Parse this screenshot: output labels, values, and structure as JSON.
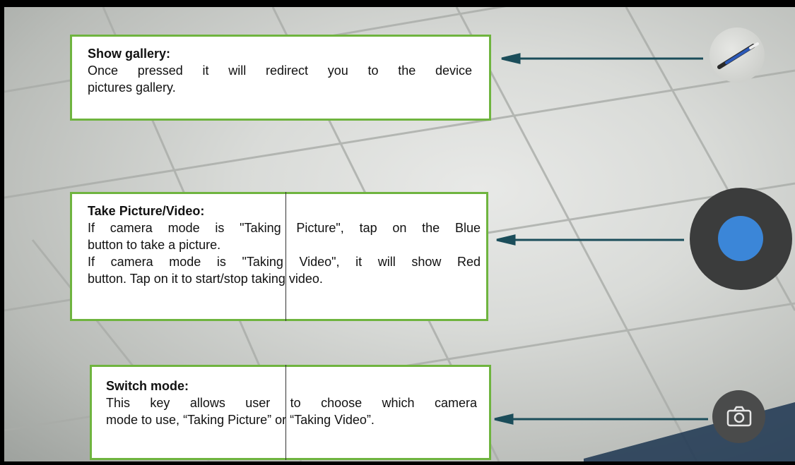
{
  "callouts": {
    "gallery": {
      "title": "Show gallery:",
      "lines": [
        "Once pressed it will redirect you to the device",
        "pictures gallery."
      ]
    },
    "take": {
      "title": "Take Picture/Video:",
      "lines": [
        "If camera mode is \"Taking Picture\", tap on the Blue",
        "button to take a picture.",
        "If camera mode is \"Taking Video\", it will show Red",
        "button. Tap on it to start/stop taking video."
      ]
    },
    "switch": {
      "title": "Switch mode:",
      "lines": [
        "This key allows user to choose which camera",
        "mode to use, “Taking Picture” or “Taking Video”."
      ]
    }
  },
  "controls": {
    "gallery_icon": "gallery-thumbnail-icon",
    "shutter_icon": "shutter-icon",
    "shutter_color": "#3b86d8",
    "mode_icon": "camera-icon"
  },
  "colors": {
    "callout_border": "#6fb43f",
    "arrow": "#1b4d5a",
    "shutter_ring": "#3b3c3c"
  }
}
